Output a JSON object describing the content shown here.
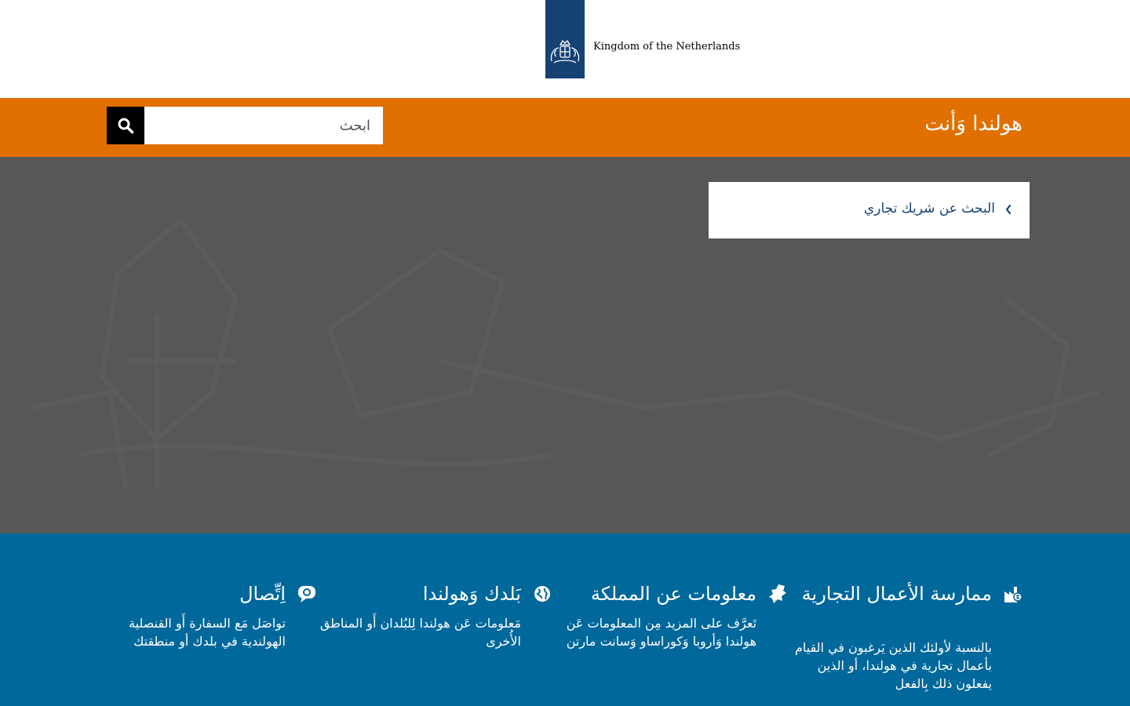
{
  "header": {
    "logo_text": "Kingdom of the Netherlands",
    "logo_icon": "royal-coat-of-arms-icon"
  },
  "topbar": {
    "site_title": "هولندا وَأنت",
    "search": {
      "placeholder": "ابحث",
      "value": "",
      "button_icon": "search-icon"
    }
  },
  "hero": {
    "breadcrumb_link": "البحث عن شريك تجاري",
    "breadcrumb_icon": "chevron-left-icon"
  },
  "tiles": [
    {
      "title": "ممارسة الأعمال التجارية",
      "description": "بالنسبة لأولئك الذين يَرغبون في القيام بأعمال تجارية في هولندا، أو الذين يفعلون ذلك بِالفعل",
      "icon": "factory-icon"
    },
    {
      "title": "معلومات عن المملكة",
      "description": "تَعرَّف على المزيد مِن المعلومات عَن هولندا وَأروبا وَكوراساو وَسانت مارتن",
      "icon": "netherlands-map-icon"
    },
    {
      "title": "بَلدك وَهولندا",
      "description": "مَعلومات عَن هولندا لِلبُلدان أَو المناطق الأُخرى",
      "icon": "globe-icon"
    },
    {
      "title": "اِتِّصال",
      "description": "تواصَل مَع السفارة أَو القنصلية الهولندية في بلدك أو منطقتك",
      "icon": "speech-bubble-icon"
    }
  ],
  "colors": {
    "brand_blue": "#154273",
    "orange": "#e17000",
    "tile_blue": "#01689b",
    "hero_gray": "#575757"
  }
}
